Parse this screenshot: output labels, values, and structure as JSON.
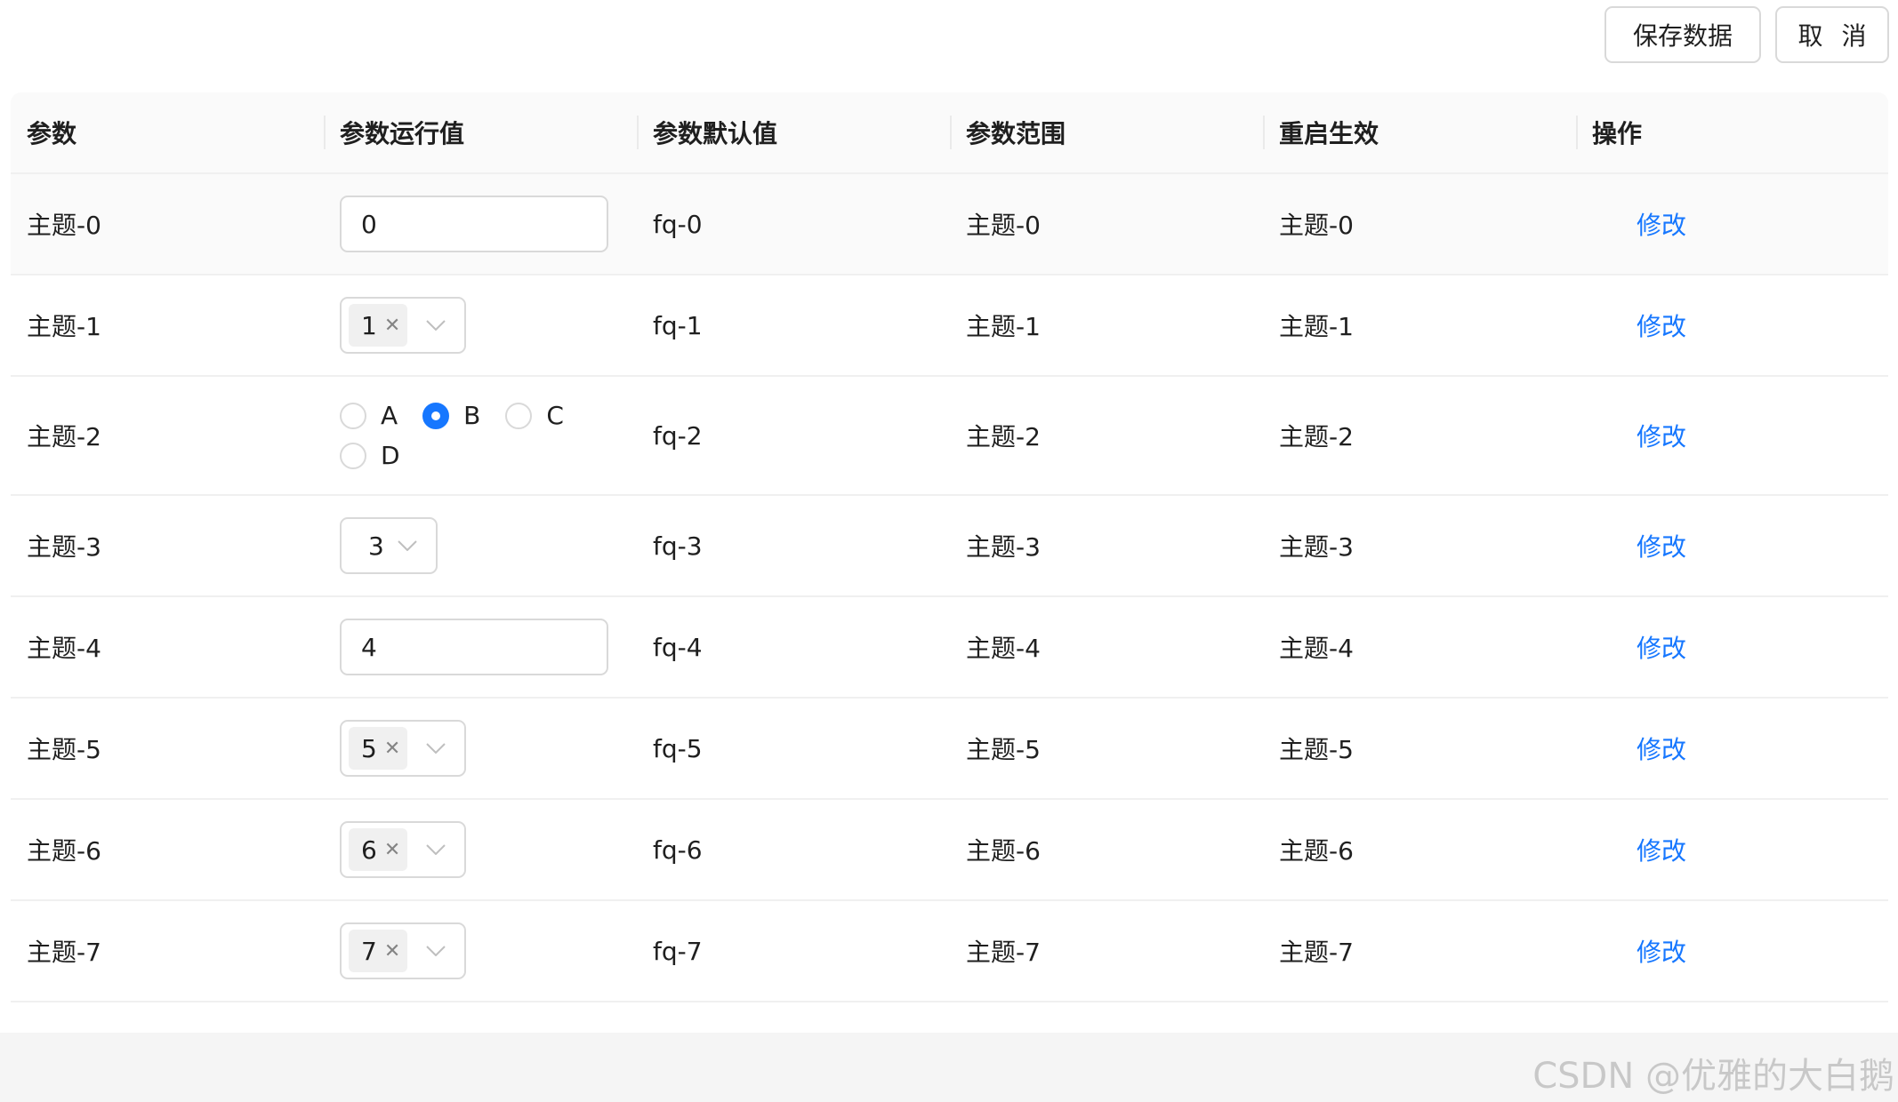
{
  "toolbar": {
    "save_label": "保存数据",
    "cancel_label": "取 消"
  },
  "table": {
    "headers": [
      "参数",
      "参数运行值",
      "参数默认值",
      "参数范围",
      "重启生效",
      "操作"
    ],
    "rows": [
      {
        "param": "主题-0",
        "control": "input",
        "value": "0",
        "default": "fq-0",
        "range": "主题-0",
        "restart": "主题-0",
        "action": "修改"
      },
      {
        "param": "主题-1",
        "control": "multi-select",
        "value": "1",
        "default": "fq-1",
        "range": "主题-1",
        "restart": "主题-1",
        "action": "修改"
      },
      {
        "param": "主题-2",
        "control": "radio",
        "options": [
          "A",
          "B",
          "C",
          "D"
        ],
        "selected": "B",
        "default": "fq-2",
        "range": "主题-2",
        "restart": "主题-2",
        "action": "修改"
      },
      {
        "param": "主题-3",
        "control": "select",
        "value": "3",
        "default": "fq-3",
        "range": "主题-3",
        "restart": "主题-3",
        "action": "修改"
      },
      {
        "param": "主题-4",
        "control": "input",
        "value": "4",
        "default": "fq-4",
        "range": "主题-4",
        "restart": "主题-4",
        "action": "修改"
      },
      {
        "param": "主题-5",
        "control": "multi-select",
        "value": "5",
        "default": "fq-5",
        "range": "主题-5",
        "restart": "主题-5",
        "action": "修改"
      },
      {
        "param": "主题-6",
        "control": "multi-select",
        "value": "6",
        "default": "fq-6",
        "range": "主题-6",
        "restart": "主题-6",
        "action": "修改"
      },
      {
        "param": "主题-7",
        "control": "multi-select",
        "value": "7",
        "default": "fq-7",
        "range": "主题-7",
        "restart": "主题-7",
        "action": "修改"
      }
    ]
  },
  "colors": {
    "primary": "#1677ff",
    "border": "#d9d9d9",
    "header_bg": "#fafafa"
  },
  "watermark": "CSDN @优雅的大白鹅"
}
